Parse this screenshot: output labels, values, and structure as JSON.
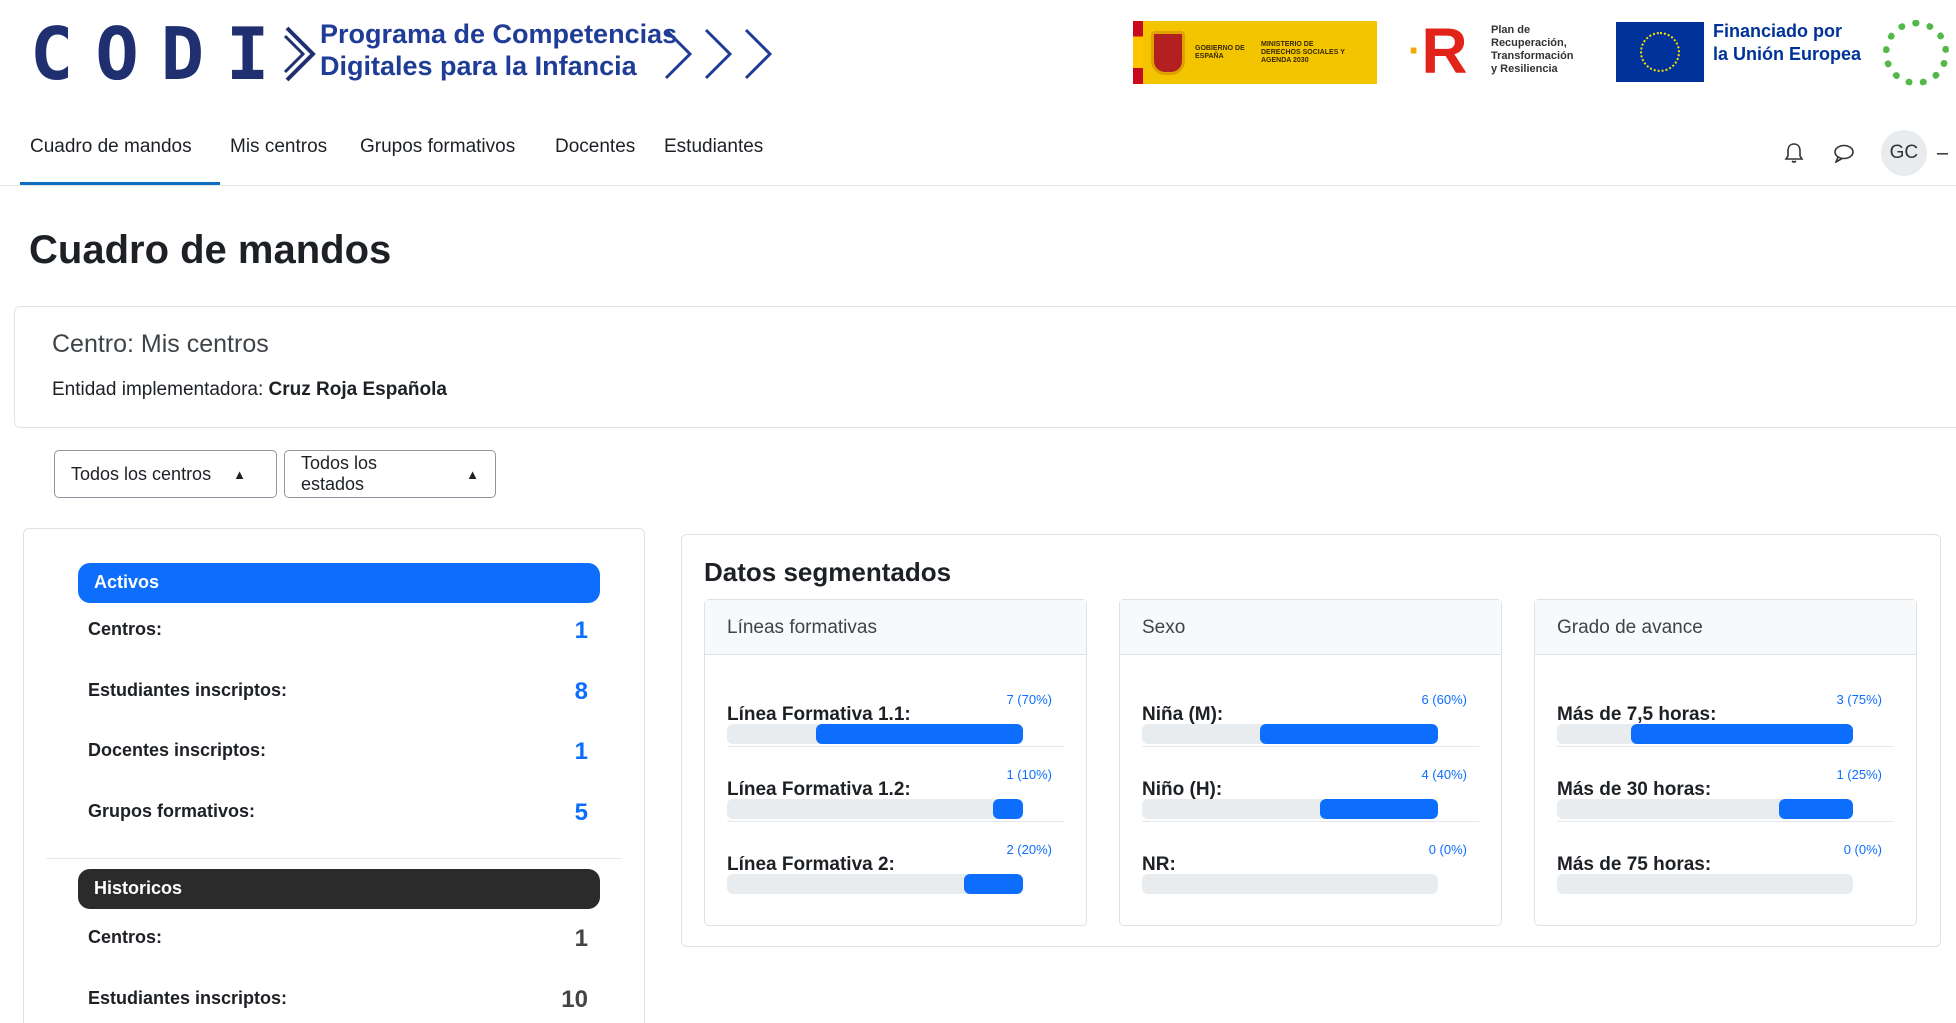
{
  "brand": {
    "logo_text": "CODI",
    "tagline_line1": "Programa de Competencias",
    "tagline_line2": "Digitales para la Infancia",
    "gobierno_text": "GOBIERNO DE ESPAÑA",
    "ministerio_text": "MINISTERIO DE DERECHOS SOCIALES Y AGENDA 2030",
    "prtr_text": [
      "Plan de",
      "Recuperación,",
      "Transformación",
      "y Resiliencia"
    ],
    "eu_text_line1": "Financiado por",
    "eu_text_line2": "la Unión Europea"
  },
  "nav": {
    "items": [
      "Cuadro de mandos",
      "Mis centros",
      "Grupos formativos",
      "Docentes",
      "Estudiantes"
    ],
    "active_index": 0,
    "user_initials": "GC",
    "icons": [
      "bell-icon",
      "chat-icon"
    ]
  },
  "page": {
    "title": "Cuadro de mandos",
    "centro_label": "Centro: Mis centros",
    "entidad_prefix": "Entidad implementadora: ",
    "entidad_value": "Cruz Roja Española"
  },
  "filters": {
    "centros_selected": "Todos los centros",
    "estados_selected": "Todos los estados"
  },
  "activos": {
    "title": "Activos",
    "rows": [
      {
        "label": "Centros:",
        "value": "1"
      },
      {
        "label": "Estudiantes inscriptos:",
        "value": "8"
      },
      {
        "label": "Docentes inscriptos:",
        "value": "1"
      },
      {
        "label": "Grupos formativos:",
        "value": "5"
      }
    ]
  },
  "historicos": {
    "title": "Historicos",
    "rows": [
      {
        "label": "Centros:",
        "value": "1"
      },
      {
        "label": "Estudiantes inscriptos:",
        "value": "10"
      }
    ]
  },
  "segmented": {
    "title": "Datos segmentados",
    "cards": [
      {
        "title": "Líneas formativas",
        "rows": [
          {
            "label": "Línea Formativa 1.1:",
            "value": "7 (70%)",
            "pct": 70
          },
          {
            "label": "Línea Formativa 1.2:",
            "value": "1 (10%)",
            "pct": 10
          },
          {
            "label": "Línea Formativa 2:",
            "value": "2 (20%)",
            "pct": 20
          }
        ]
      },
      {
        "title": "Sexo",
        "rows": [
          {
            "label": "Niña (M):",
            "value": "6 (60%)",
            "pct": 60
          },
          {
            "label": "Niño (H):",
            "value": "4 (40%)",
            "pct": 40
          },
          {
            "label": "NR:",
            "value": "0 (0%)",
            "pct": 0
          }
        ]
      },
      {
        "title": "Grado de avance",
        "rows": [
          {
            "label": "Más de 7,5 horas:",
            "value": "3 (75%)",
            "pct": 75
          },
          {
            "label": "Más de 30 horas:",
            "value": "1 (25%)",
            "pct": 25
          },
          {
            "label": "Más de 75 horas:",
            "value": "0 (0%)",
            "pct": 0
          }
        ]
      }
    ]
  }
}
